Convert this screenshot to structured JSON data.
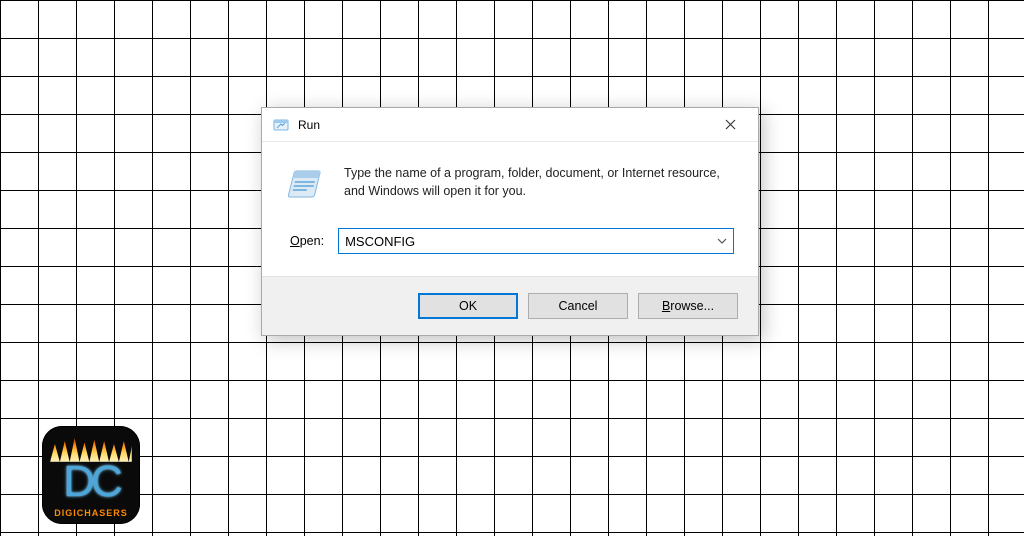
{
  "dialog": {
    "title": "Run",
    "message": "Type the name of a program, folder, document, or Internet resource, and Windows will open it for you.",
    "open_label_prefix": "O",
    "open_label_rest": "pen:",
    "input_value": "MSCONFIG",
    "buttons": {
      "ok": "OK",
      "cancel": "Cancel",
      "browse_prefix": "B",
      "browse_rest": "rowse..."
    }
  },
  "watermark": {
    "monogram": "DC",
    "subtitle": "DIGICHASERS"
  }
}
